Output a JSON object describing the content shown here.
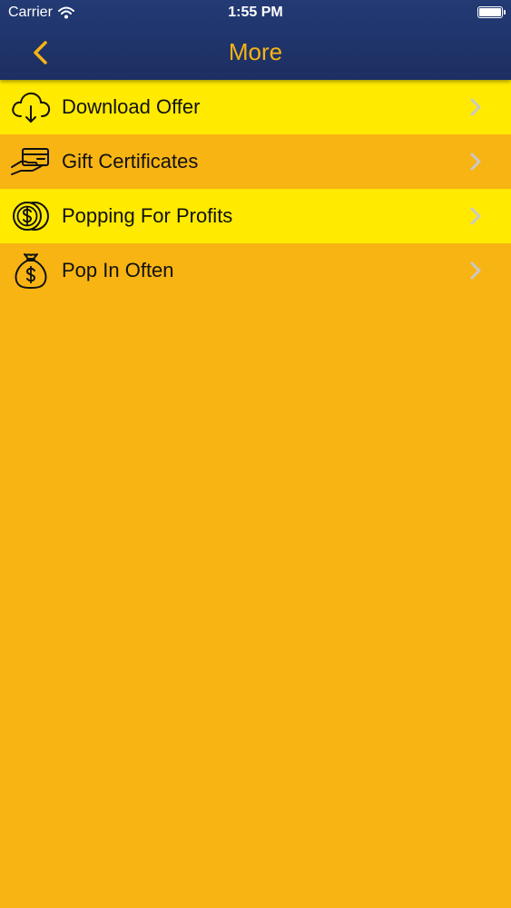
{
  "status_bar": {
    "carrier": "Carrier",
    "time": "1:55 PM",
    "battery_level": 1.0
  },
  "nav": {
    "title": "More",
    "back_icon": "chevron-left-icon"
  },
  "colors": {
    "nav_background": "#1f3369",
    "accent": "#f7b413",
    "row_light": "#ffea00",
    "row_dark": "#f7b413",
    "chevron": "#c9c9c9"
  },
  "menu": {
    "items": [
      {
        "label": "Download Offer",
        "icon": "cloud-download-icon"
      },
      {
        "label": "Gift Certificates",
        "icon": "gift-card-hand-icon"
      },
      {
        "label": "Popping For Profits",
        "icon": "coins-icon"
      },
      {
        "label": "Pop In Often",
        "icon": "money-bag-icon"
      }
    ]
  }
}
